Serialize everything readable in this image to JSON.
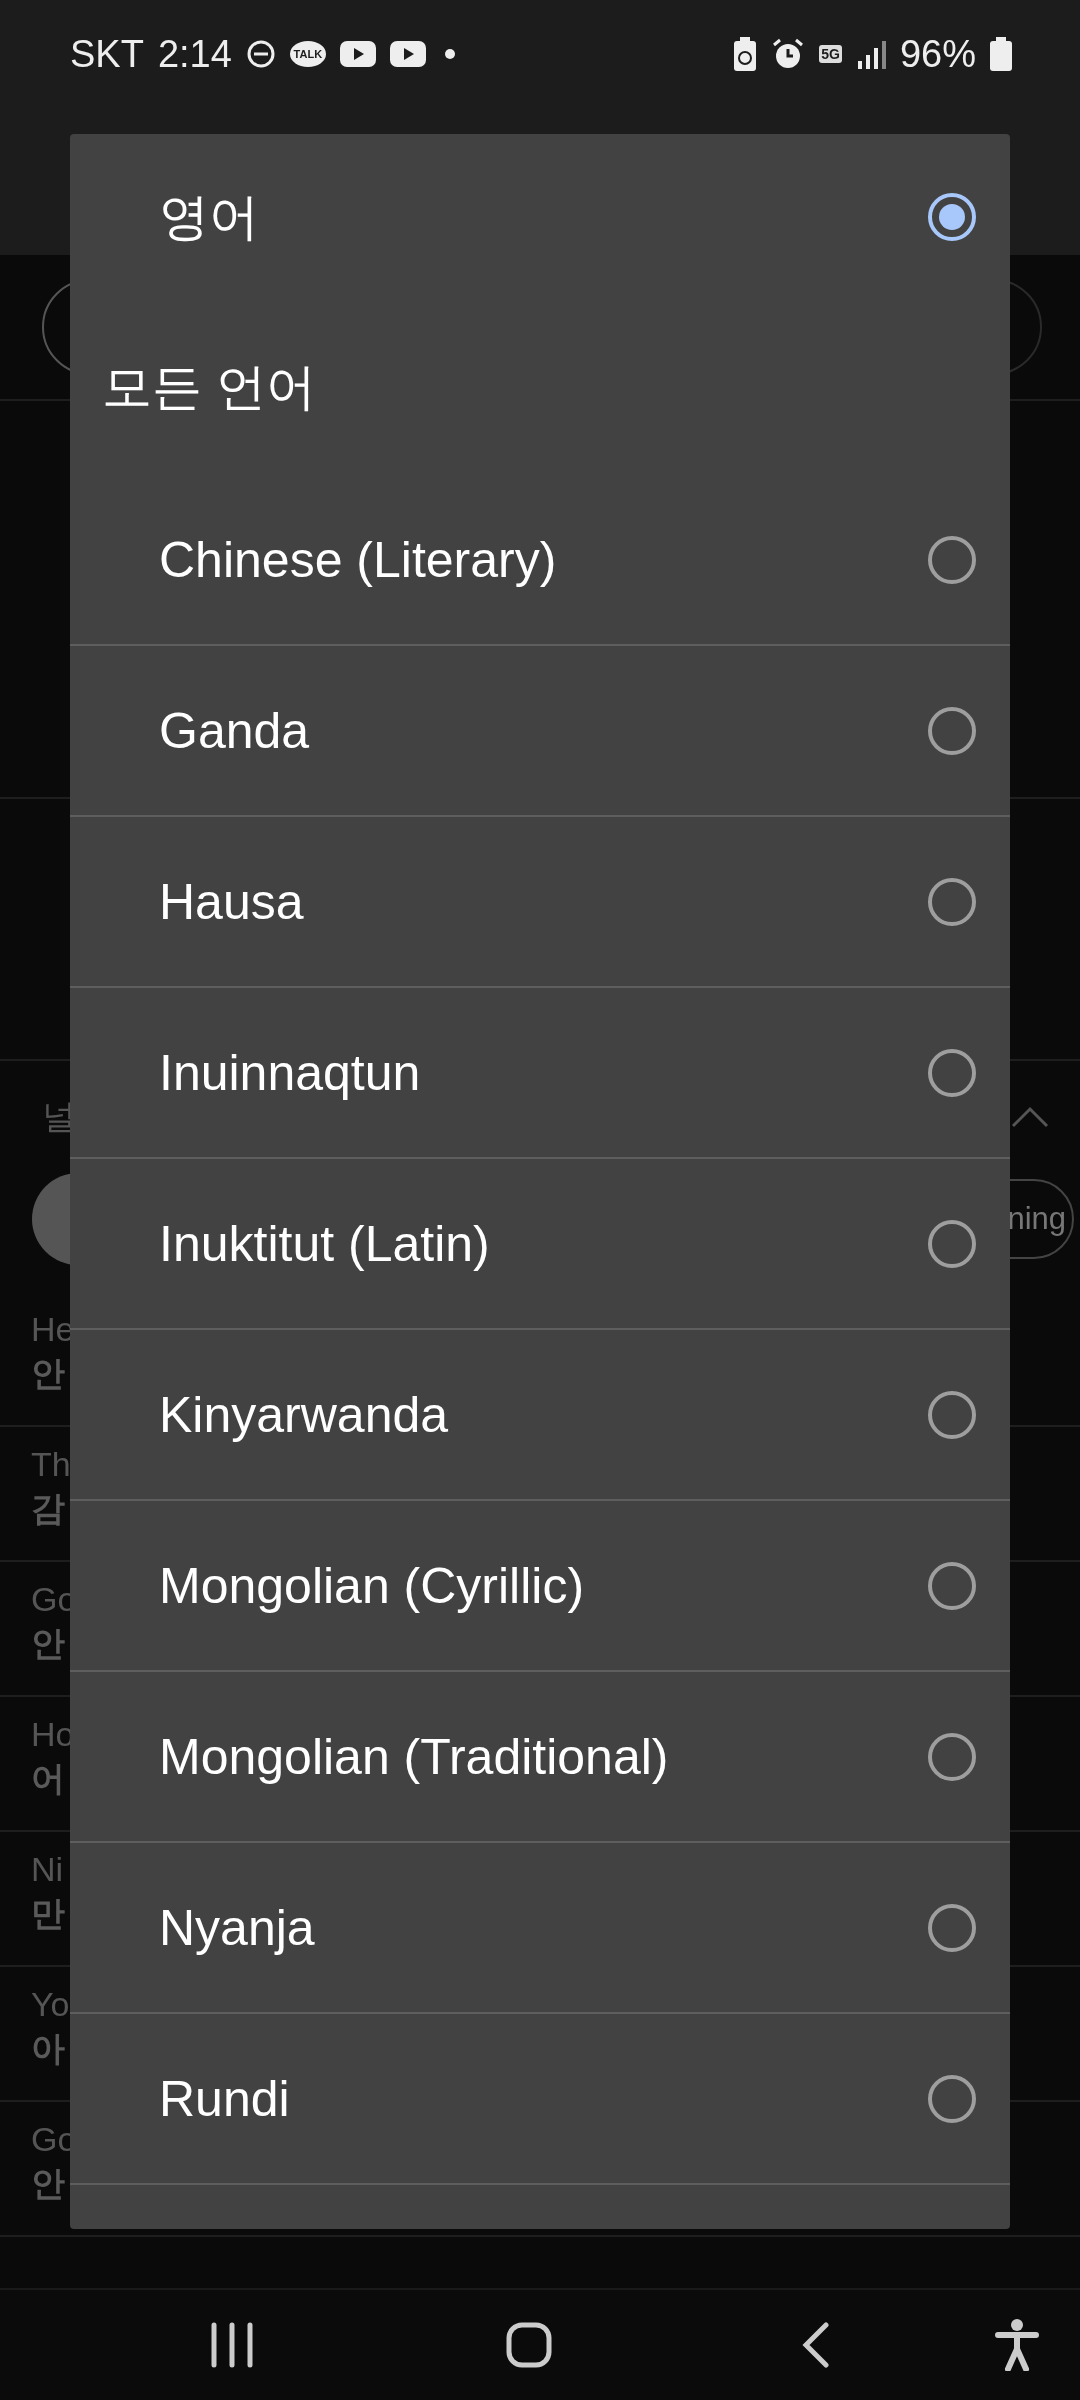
{
  "status_bar": {
    "carrier": "SKT",
    "time": "2:14",
    "talk_badge": "TALK",
    "network": "5G",
    "battery": "96%"
  },
  "background": {
    "section_label": "널",
    "chip": "ning",
    "phrases": [
      {
        "english": "He",
        "korean": "안"
      },
      {
        "english": "Th",
        "korean": "감"
      },
      {
        "english": "Go",
        "korean": "안"
      },
      {
        "english": "Ho",
        "korean": "어"
      },
      {
        "english": "Ni",
        "korean": "만"
      },
      {
        "english": "Yo",
        "korean": "아"
      },
      {
        "english": "Go",
        "korean": "안"
      }
    ]
  },
  "dialog": {
    "current": [
      {
        "label": "영어",
        "selected": true
      }
    ],
    "section": "모든 언어",
    "languages": [
      {
        "label": "Chinese (Literary)",
        "selected": false
      },
      {
        "label": "Ganda",
        "selected": false
      },
      {
        "label": "Hausa",
        "selected": false
      },
      {
        "label": "Inuinnaqtun",
        "selected": false
      },
      {
        "label": "Inuktitut (Latin)",
        "selected": false
      },
      {
        "label": "Kinyarwanda",
        "selected": false
      },
      {
        "label": "Mongolian (Cyrillic)",
        "selected": false
      },
      {
        "label": "Mongolian (Traditional)",
        "selected": false
      },
      {
        "label": "Nyanja",
        "selected": false
      },
      {
        "label": "Rundi",
        "selected": false
      }
    ]
  }
}
